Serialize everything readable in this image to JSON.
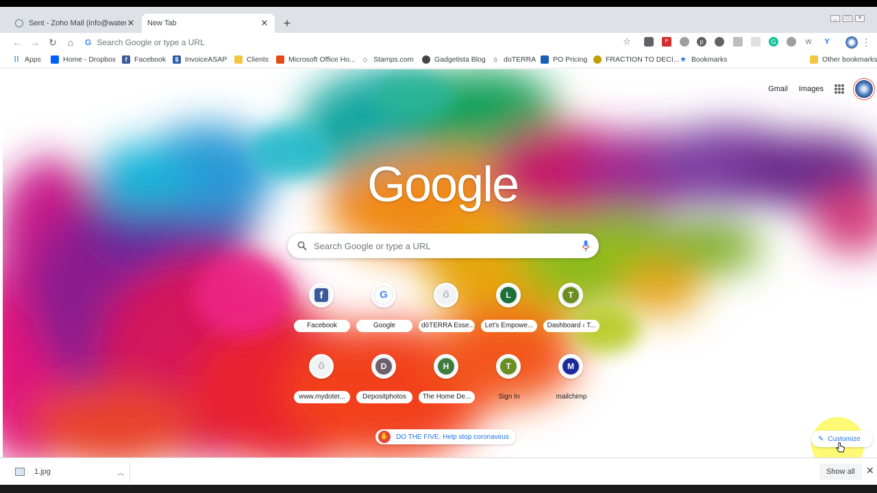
{
  "tabs": [
    {
      "title": "Sent - Zoho Mail (info@waterbur...",
      "active": false,
      "icon": "zoho-mail-icon"
    },
    {
      "title": "New Tab",
      "active": true
    }
  ],
  "toolbar": {
    "omnibox_placeholder": "Search Google or type a URL"
  },
  "bookmarks": [
    {
      "label": "Apps",
      "icon": "apps-grid-icon",
      "color": "#4285f4"
    },
    {
      "label": "Home - Dropbox",
      "icon": "dropbox-icon",
      "color": "#0061ff"
    },
    {
      "label": "Facebook",
      "icon": "facebook-icon",
      "color": "#3b5998"
    },
    {
      "label": "InvoiceASAP",
      "icon": "invoiceasap-icon",
      "color": "#2a5ba8"
    },
    {
      "label": "Clients",
      "icon": "folder-icon",
      "color": "#f5c542"
    },
    {
      "label": "Microsoft Office Ho...",
      "icon": "office-icon",
      "color": "#e64a19"
    },
    {
      "label": "Stamps.com",
      "icon": "stamps-icon",
      "color": "#555555"
    },
    {
      "label": "Gadgetista Blog",
      "icon": "blog-icon",
      "color": "#444444"
    },
    {
      "label": "doTERRA",
      "icon": "doterra-icon",
      "color": "#9e9e9e"
    },
    {
      "label": "PO Pricing",
      "icon": "po-pricing-icon",
      "color": "#1a5fb4"
    },
    {
      "label": "FRACTION TO DECI...",
      "icon": "fraction-icon",
      "color": "#c0a000"
    },
    {
      "label": "Bookmarks",
      "icon": "star-icon",
      "color": "#1a73e8"
    },
    {
      "label": "Other bookmarks",
      "icon": "folder-icon",
      "color": "#f5c542"
    }
  ],
  "header_links": {
    "gmail": "Gmail",
    "images": "Images"
  },
  "logo": "Google",
  "search": {
    "placeholder": "Search Google or type a URL"
  },
  "shortcuts": [
    {
      "label": "Facebook",
      "letter": "f",
      "bg": "#3b5998",
      "icon": "facebook-icon"
    },
    {
      "label": "Google",
      "letter": "G",
      "bg": "#ffffff",
      "icon": "google-g-icon"
    },
    {
      "label": "dōTERRA Esse...",
      "letter": "ō",
      "bg": "#e8e8e8",
      "icon": "doterra-icon"
    },
    {
      "label": "Let's Empowe...",
      "letter": "L",
      "bg": "#1e6f3a",
      "icon": "letter-l-icon"
    },
    {
      "label": "Dashboard ‹ T...",
      "letter": "T",
      "bg": "#6b8e23",
      "icon": "letter-t-icon"
    },
    {
      "label": "www.mydoter...",
      "letter": "ō",
      "bg": "#e8e8e8",
      "icon": "doterra-icon"
    },
    {
      "label": "Depositphotos",
      "letter": "D",
      "bg": "#6d5f6b",
      "icon": "letter-d-icon"
    },
    {
      "label": "The Home De...",
      "letter": "H",
      "bg": "#3d7a3d",
      "icon": "letter-h-icon"
    },
    {
      "label": "Sign In",
      "letter": "T",
      "bg": "#6b8e23",
      "icon": "letter-t-icon"
    },
    {
      "label": "mailchimp",
      "letter": "M",
      "bg": "#1a2a9a",
      "icon": "letter-m-icon"
    }
  ],
  "promo": {
    "text": "DO THE FIVE. Help stop coronavirus"
  },
  "customize": {
    "label": "Customize"
  },
  "downloads": {
    "file": "1.jpg",
    "show_all": "Show all"
  },
  "colors": {
    "accent": "#1a73e8",
    "tabstrip": "#dee1e6"
  }
}
